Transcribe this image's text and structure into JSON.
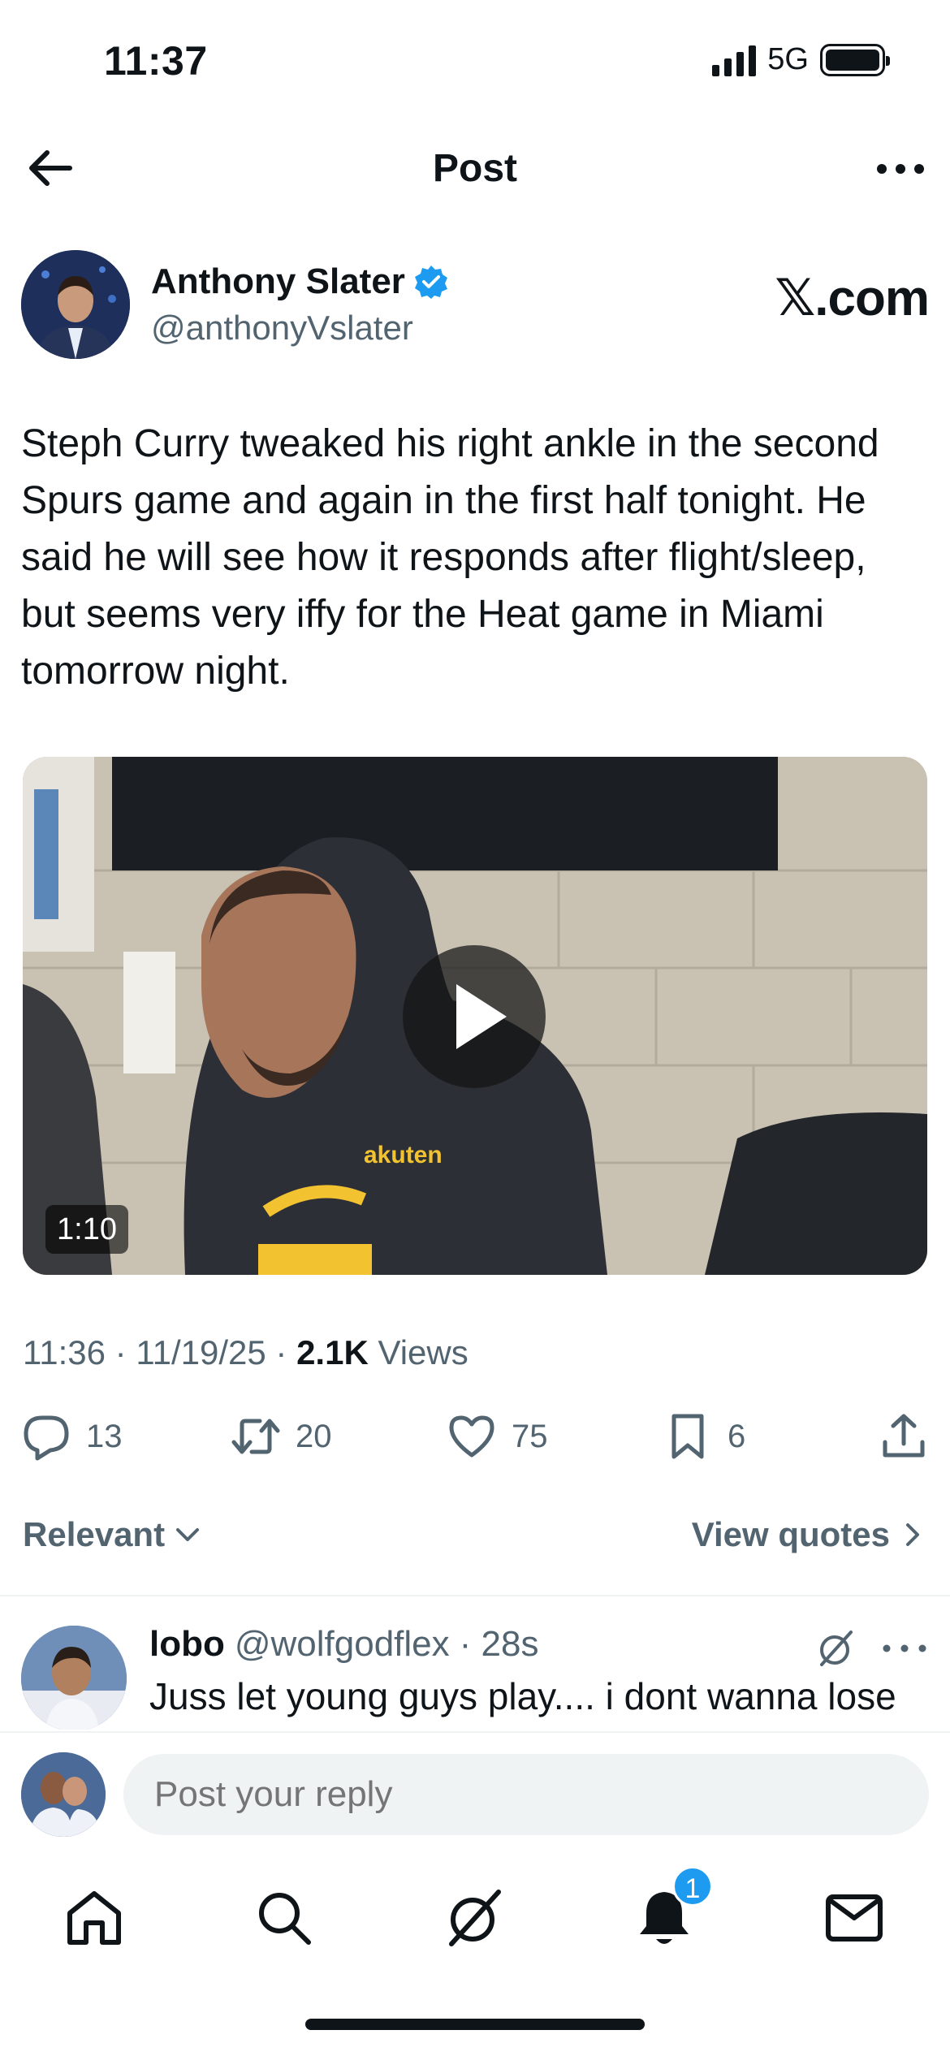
{
  "status_bar": {
    "time": "11:37",
    "network": "5G"
  },
  "nav": {
    "title": "Post"
  },
  "author": {
    "name": "Anthony Slater",
    "handle": "@anthonyVslater",
    "source_logo": "𝕏.com"
  },
  "tweet": {
    "text": "Steph Curry tweaked his right ankle in the second Spurs game and again in the first half tonight. He said he will see how it responds after flight/sleep, but seems very iffy for the Heat game in Miami tomorrow night.",
    "video_duration": "1:10",
    "time": "11:36",
    "date": "11/19/25",
    "views_count": "2.1K",
    "views_label": "Views",
    "sep": "·"
  },
  "actions": {
    "replies": "13",
    "reposts": "20",
    "likes": "75",
    "bookmarks": "6"
  },
  "sort": {
    "relevant_label": "Relevant",
    "view_quotes_label": "View quotes"
  },
  "reply": {
    "name": "lobo",
    "handle": "@wolfgodflex",
    "time": "· 28s",
    "text": "Juss let young guys play.... i dont wanna lose anymore toos... But this great mtest though"
  },
  "composer": {
    "placeholder": "Post your reply"
  },
  "tabbar": {
    "notifications_badge": "1"
  },
  "icons": [
    "back-arrow-icon",
    "more-icon",
    "verified-icon",
    "play-icon",
    "reply-icon",
    "repost-icon",
    "like-icon",
    "bookmark-icon",
    "share-icon",
    "chevron-down-icon",
    "chevron-right-icon",
    "grok-icon",
    "home-icon",
    "search-icon",
    "notifications-icon",
    "messages-icon"
  ],
  "colors": {
    "accent": "#1d9bf0",
    "text": "#0f1419",
    "secondary": "#536471"
  }
}
